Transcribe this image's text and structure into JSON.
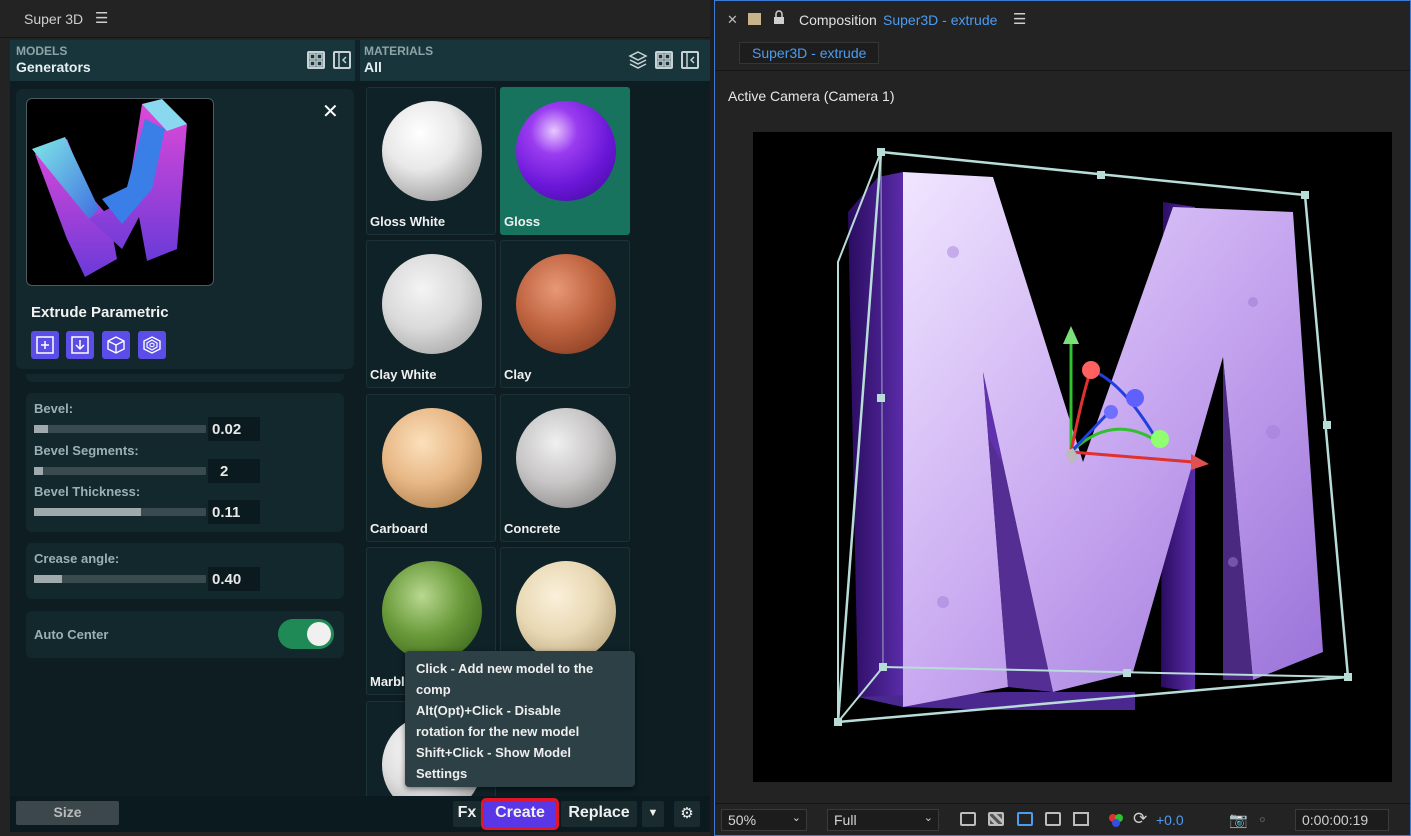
{
  "left_panel": {
    "title": "Super 3D",
    "menu_icon": "hamburger-icon"
  },
  "models": {
    "section": "MODELS",
    "category": "Generators",
    "selected_model": {
      "name": "Extrude Parametric"
    },
    "actions": [
      "add-icon",
      "download-icon",
      "cube-icon",
      "sphere-grid-icon"
    ],
    "params": [
      {
        "label": "Bevel:",
        "value": "0.02",
        "fill": 0.08
      },
      {
        "label": "Bevel Segments:",
        "value": "2",
        "fill": 0.05
      },
      {
        "label": "Bevel Thickness:",
        "value": "0.11",
        "fill": 0.62
      }
    ],
    "crease": {
      "label": "Crease angle:",
      "value": "0.40",
      "fill": 0.16
    },
    "auto_center": {
      "label": "Auto Center",
      "on": true
    }
  },
  "materials": {
    "section": "MATERIALS",
    "category": "All",
    "items": [
      {
        "label": "Gloss White",
        "selected": false
      },
      {
        "label": "Gloss",
        "selected": true
      },
      {
        "label": "Clay White",
        "selected": false
      },
      {
        "label": "Clay",
        "selected": false
      },
      {
        "label": "Carboard",
        "selected": false
      },
      {
        "label": "Concrete",
        "selected": false
      },
      {
        "label": "Marble",
        "selected": false
      },
      {
        "label": "",
        "selected": false
      }
    ]
  },
  "tooltip": {
    "lines": [
      "Click - Add new model to the",
      "comp",
      "Alt(Opt)+Click - Disable",
      "rotation for the new model",
      "Shift+Click - Show Model",
      "Settings"
    ]
  },
  "footer": {
    "size": "Size",
    "fx": "Fx",
    "create": "Create",
    "replace": "Replace"
  },
  "composition": {
    "label": "Composition",
    "name": "Super3D - extrude",
    "tab": "Super3D - extrude",
    "camera": "Active Camera (Camera 1)",
    "zoom": "50%",
    "resolution": "Full",
    "exposure": "+0.0",
    "timecode": "0:00:00:19"
  }
}
